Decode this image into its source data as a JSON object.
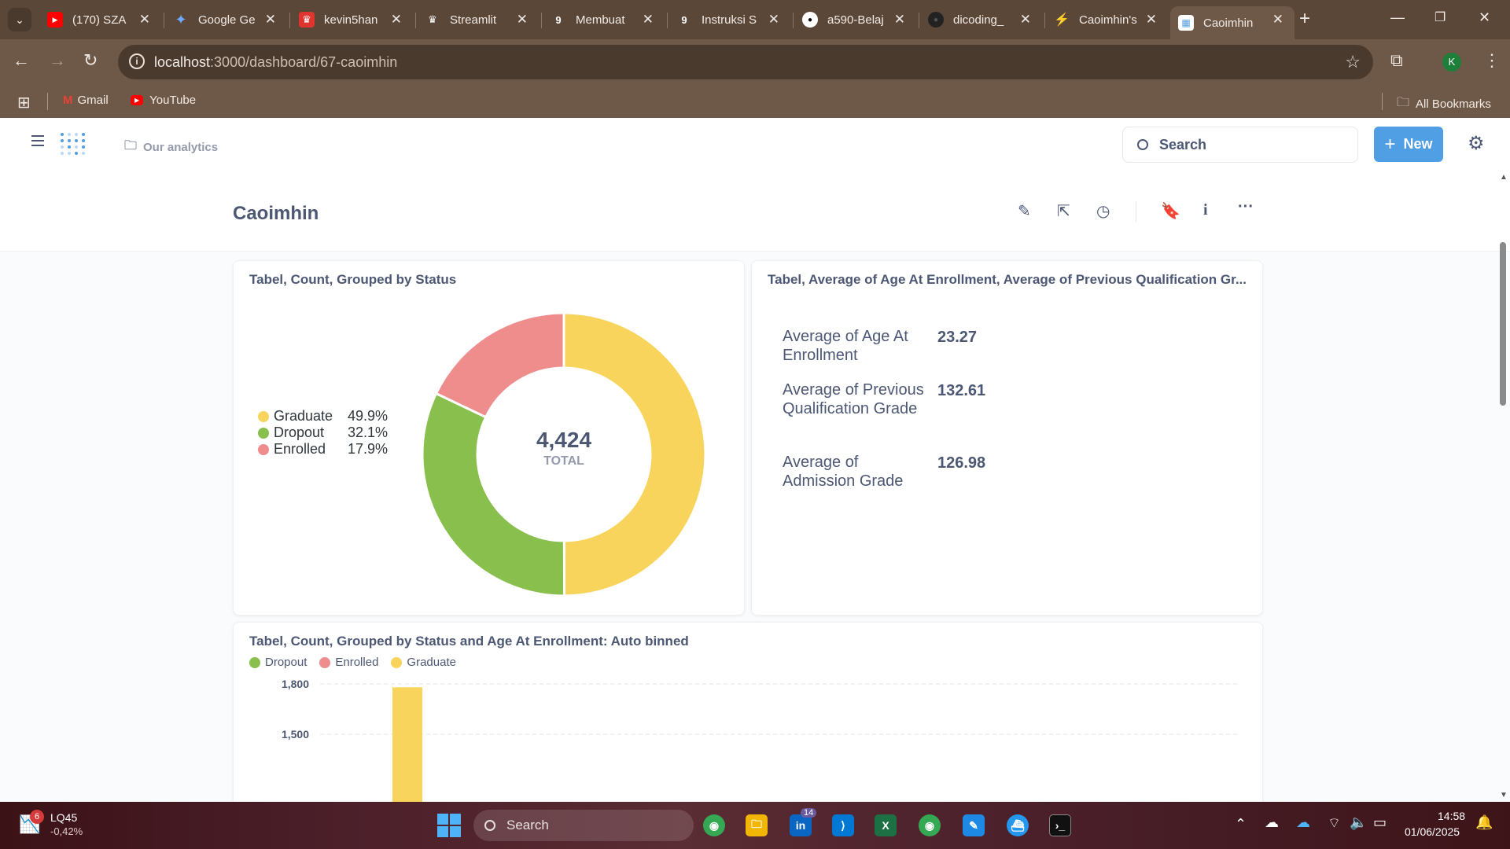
{
  "browser": {
    "tabs": [
      {
        "title": "(170) SZA",
        "fav": "▶",
        "fav_color": "#ff0000"
      },
      {
        "title": "Google Ge",
        "fav": "✦",
        "fav_color": "#5b4738"
      },
      {
        "title": "kevin5han",
        "fav": "♛",
        "fav_color": "#e0342f"
      },
      {
        "title": "Streamlit",
        "fav": "♛",
        "fav_color": "#5b4738"
      },
      {
        "title": "Membuat",
        "fav": "9",
        "fav_color": "#5b4738"
      },
      {
        "title": "Instruksi S",
        "fav": "9",
        "fav_color": "#5b4738"
      },
      {
        "title": "a590-Belaj",
        "fav": "●",
        "fav_color": "#5b4738"
      },
      {
        "title": "dicoding_",
        "fav": "●",
        "fav_color": "#5b4738"
      },
      {
        "title": "Caoimhin's",
        "fav": "⚡",
        "fav_color": "#5b4738"
      },
      {
        "title": "Caoimhin",
        "fav": "▦",
        "fav_color": "#ffffff"
      }
    ],
    "url_host": "localhost",
    "url_path": ":3000/dashboard/67-caoimhin",
    "bookmarks": [
      "Gmail",
      "YouTube"
    ],
    "all_bookmarks": "All Bookmarks",
    "profile_initial": "K"
  },
  "app": {
    "breadcrumb": "Our analytics",
    "search_placeholder": "Search",
    "new_label": "New"
  },
  "dashboard": {
    "title": "Caoimhin"
  },
  "cards": {
    "donut": {
      "title": "Tabel, Count, Grouped by Status",
      "total": "4,424",
      "total_label": "TOTAL",
      "legend": [
        {
          "name": "Graduate",
          "pct": "49.9%",
          "color": "#f9d45c"
        },
        {
          "name": "Dropout",
          "pct": "32.1%",
          "color": "#88bf4d"
        },
        {
          "name": "Enrolled",
          "pct": "17.9%",
          "color": "#ef8c8c"
        }
      ]
    },
    "scalars": {
      "title": "Tabel, Average of Age At Enrollment, Average of Previous Qualification Gr...",
      "rows": [
        {
          "label": "Average of Age At Enrollment",
          "value": "23.27"
        },
        {
          "label": "Average of Previous Qualification Grade",
          "value": "132.61"
        },
        {
          "label": "Average of Admission Grade",
          "value": "126.98"
        }
      ]
    },
    "bars": {
      "title": "Tabel, Count, Grouped by Status and Age At Enrollment: Auto binned",
      "legend": [
        {
          "name": "Dropout",
          "color": "#88bf4d"
        },
        {
          "name": "Enrolled",
          "color": "#ef8c8c"
        },
        {
          "name": "Graduate",
          "color": "#f9d45c"
        }
      ],
      "yticks": [
        "1,800",
        "1,500"
      ]
    }
  },
  "chart_data": [
    {
      "type": "pie",
      "title": "Tabel, Count, Grouped by Status",
      "categories": [
        "Graduate",
        "Dropout",
        "Enrolled"
      ],
      "values": [
        49.9,
        32.1,
        17.9
      ],
      "total": 4424,
      "colors": [
        "#f9d45c",
        "#88bf4d",
        "#ef8c8c"
      ]
    },
    {
      "type": "bar",
      "title": "Tabel, Count, Grouped by Status and Age At Enrollment: Auto binned",
      "series": [
        {
          "name": "Dropout",
          "values": []
        },
        {
          "name": "Enrolled",
          "values": []
        },
        {
          "name": "Graduate",
          "values": [
            1780
          ]
        }
      ],
      "yticks": [
        1500,
        1800
      ],
      "ylim": [
        1350,
        1850
      ]
    }
  ],
  "taskbar": {
    "stock_name": "LQ45",
    "stock_change": "-0,42%",
    "stock_badge": "6",
    "search": "Search",
    "linkedin_badge": "14",
    "time": "14:58",
    "date": "01/06/2025"
  }
}
